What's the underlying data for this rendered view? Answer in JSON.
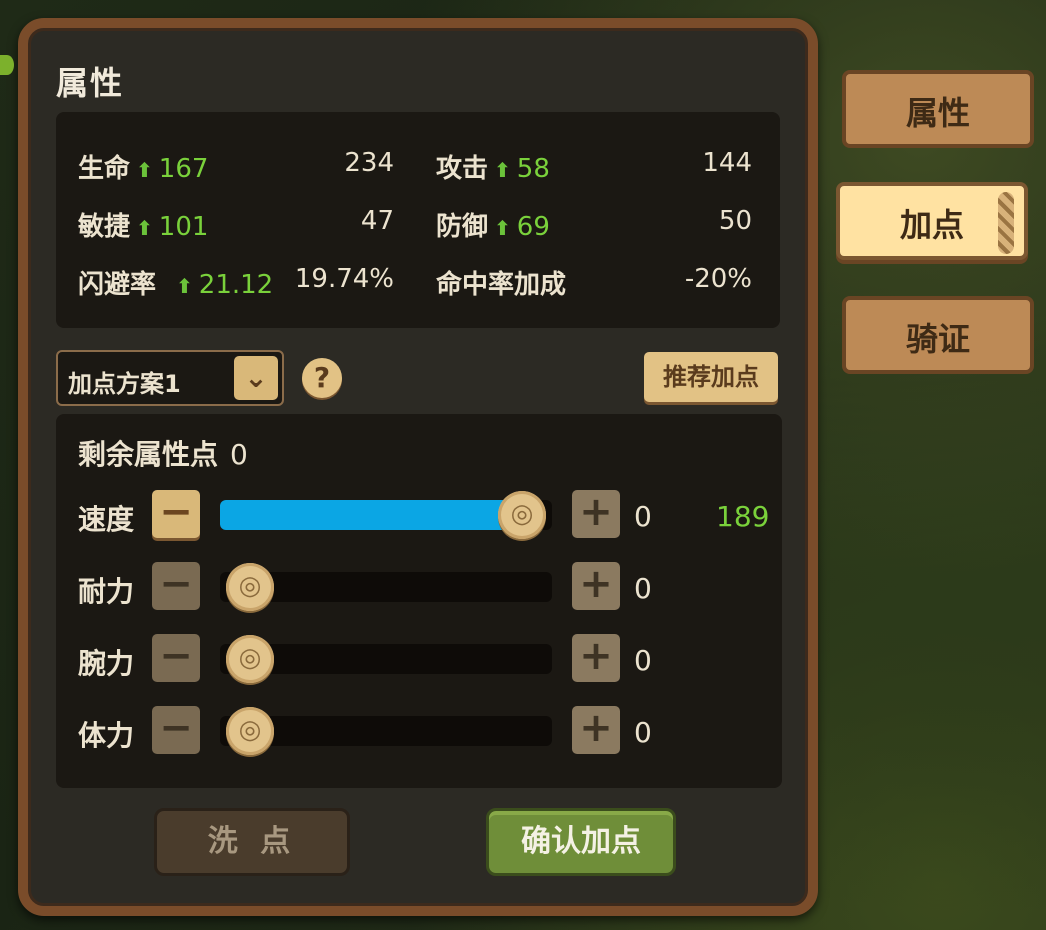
{
  "panel": {
    "title": "属性"
  },
  "stats": {
    "life": {
      "label": "生命",
      "bonus": "167",
      "value": "234"
    },
    "attack": {
      "label": "攻击",
      "bonus": "58",
      "value": "144"
    },
    "agility": {
      "label": "敏捷",
      "bonus": "101",
      "value": "47"
    },
    "defense": {
      "label": "防御",
      "bonus": "69",
      "value": "50"
    },
    "dodge": {
      "label": "闪避率",
      "bonus": "21.12",
      "value": "19.74%"
    },
    "hit_bonus": {
      "label": "命中率加成",
      "value": "-20%"
    }
  },
  "plan": {
    "selected": "加点方案1",
    "help": "?",
    "recommend_label": "推荐加点"
  },
  "points": {
    "remaining_label": "剩余属性点",
    "remaining_value": "0",
    "attributes": [
      {
        "name": "速度",
        "added": "0",
        "total": "189",
        "fill_fraction": 1.0
      },
      {
        "name": "耐力",
        "added": "0",
        "total": "",
        "fill_fraction": 0.0
      },
      {
        "name": "腕力",
        "added": "0",
        "total": "",
        "fill_fraction": 0.0
      },
      {
        "name": "体力",
        "added": "0",
        "total": "",
        "fill_fraction": 0.0
      }
    ]
  },
  "buttons": {
    "reset": "洗 点",
    "confirm": "确认加点"
  },
  "tabs": [
    {
      "label": "属性",
      "active": false
    },
    {
      "label": "加点",
      "active": true
    },
    {
      "label": "骑证",
      "active": false
    }
  ],
  "colors": {
    "accent_green": "#7ad13b",
    "slider_blue": "#0ba6e4",
    "frame_brown": "#7a4c2a"
  }
}
